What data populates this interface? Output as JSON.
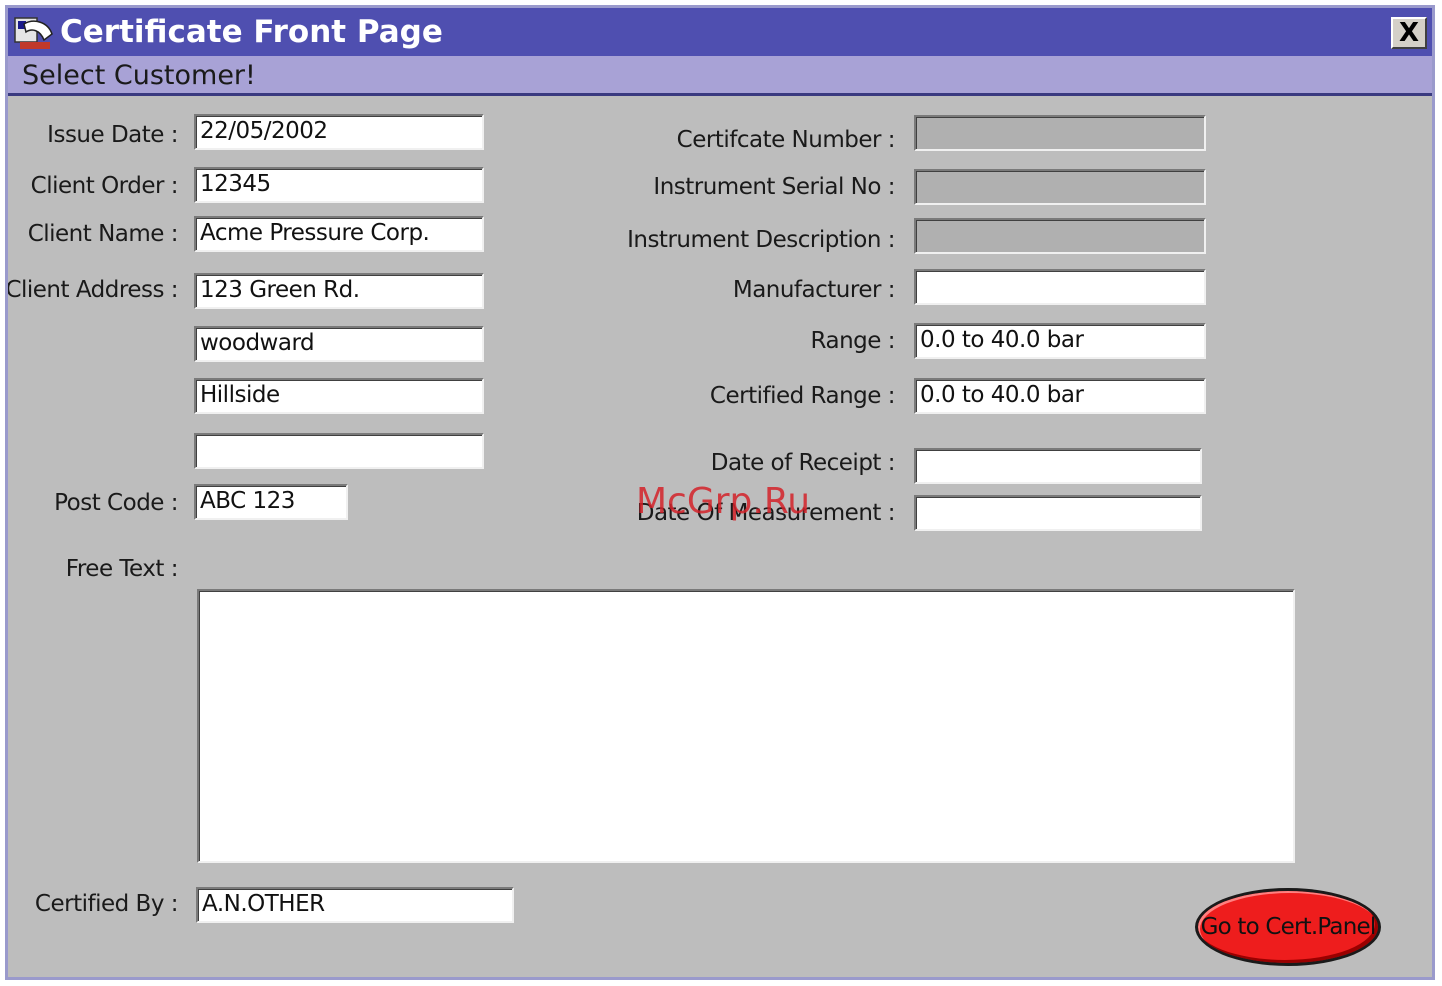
{
  "window": {
    "title": "Certificate Front Page",
    "close_label": "X",
    "subtitle": "Select Customer!"
  },
  "left_form": {
    "issue_date": {
      "label": "Issue Date :",
      "value": "22/05/2002"
    },
    "client_order": {
      "label": "Client Order :",
      "value": "12345"
    },
    "client_name": {
      "label": "Client Name :",
      "value": "Acme Pressure Corp."
    },
    "client_address": {
      "label": "Client Address :",
      "lines": [
        "123 Green Rd.",
        "woodward",
        "Hillside",
        ""
      ]
    },
    "post_code": {
      "label": "Post Code :",
      "value": "ABC 123"
    },
    "free_text": {
      "label": "Free Text :",
      "value": ""
    },
    "certified_by": {
      "label": "Certified By :",
      "value": "A.N.OTHER"
    }
  },
  "right_form": {
    "certificate_number": {
      "label": "Certifcate Number :",
      "value": ""
    },
    "instrument_serial": {
      "label": "Instrument Serial No :",
      "value": ""
    },
    "instrument_description": {
      "label": "Instrument Description :",
      "value": ""
    },
    "manufacturer": {
      "label": "Manufacturer :",
      "value": ""
    },
    "range": {
      "label": "Range :",
      "value": "0.0 to 40.0 bar"
    },
    "certified_range": {
      "label": "Certified Range :",
      "value": "0.0 to 40.0 bar"
    },
    "date_of_receipt": {
      "label": "Date of Receipt :",
      "value": ""
    },
    "date_of_measurement": {
      "label": "Date Of Measurement :",
      "value": ""
    }
  },
  "buttons": {
    "go_to_cert_panel": "Go to Cert.Panel"
  },
  "watermark": "McGrp.Ru",
  "colors": {
    "titlebar": "#4f4fb0",
    "subbar": "#a8a2d6",
    "background": "#bdbdbd",
    "go_button": "#ee1d1d"
  }
}
